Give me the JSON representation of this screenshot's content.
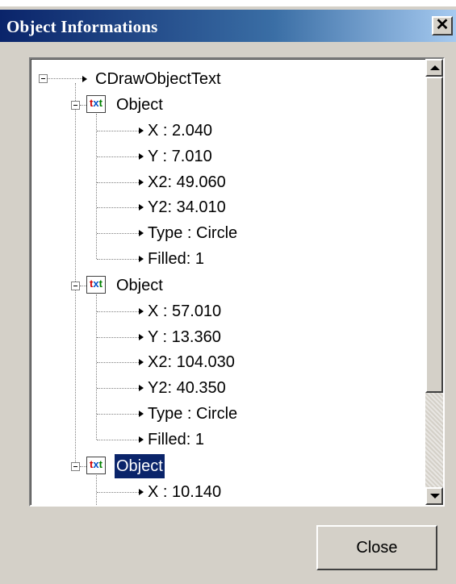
{
  "window": {
    "title": "Object Informations",
    "close_glyph": "✕"
  },
  "tree": {
    "root": "CDrawObjectText",
    "icon_letters": [
      "t",
      "x",
      "t"
    ],
    "objects": [
      {
        "label": "Object",
        "props": [
          "X : 2.040",
          "Y : 7.010",
          "X2: 49.060",
          "Y2: 34.010",
          "Type  : Circle",
          "Filled: 1"
        ]
      },
      {
        "label": "Object",
        "props": [
          "X : 57.010",
          "Y : 13.360",
          "X2: 104.030",
          "Y2: 40.350",
          "Type  : Circle",
          "Filled: 1"
        ]
      },
      {
        "label": "Object",
        "selected": true,
        "props": [
          "X : 10.140"
        ]
      }
    ]
  },
  "footer": {
    "close_label": "Close"
  }
}
